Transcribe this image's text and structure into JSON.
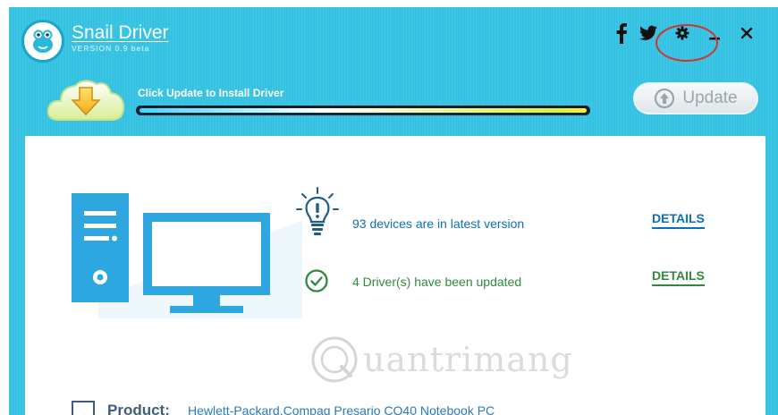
{
  "app": {
    "title": "Snail Driver",
    "version": "VERSION 0.9 beta"
  },
  "titlebar_icons": [
    "facebook-icon",
    "twitter-icon",
    "settings-icon",
    "minimize-icon",
    "close-icon"
  ],
  "update_bar": {
    "message": "Click Update to Install Driver",
    "progress": 1.0,
    "button_label": "Update"
  },
  "status": [
    {
      "text": "93 devices are in latest version",
      "action": "DETAILS",
      "icon": "lightbulb-icon",
      "color": "#0d6fb8"
    },
    {
      "text": "4 Driver(s) have been updated",
      "action": "DETAILS",
      "icon": "check-circle-icon",
      "color": "#2f8a3e"
    }
  ],
  "watermark": "uantrimang",
  "product": {
    "label": "Product:",
    "value": "Hewlett-Packard.Compaq Presario CQ40 Notebook PC"
  },
  "colors": {
    "accent": "#35c2e2",
    "link_blue": "#0d6fb8",
    "link_green": "#2f8a3e",
    "annotation_red": "#d83030"
  }
}
